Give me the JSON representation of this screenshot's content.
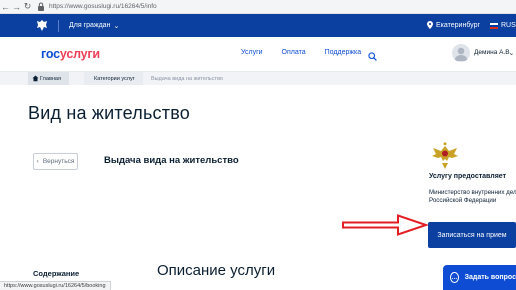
{
  "browser": {
    "url": "https://www.gosuslugi.ru/16264/5/info"
  },
  "topbar": {
    "citizens_label": "Для граждан",
    "location": "Екатеринбург",
    "language": "RUS"
  },
  "header": {
    "logo_gos": "гос",
    "logo_uslugi": "услуги",
    "nav": [
      "Услуги",
      "Оплата",
      "Поддержка"
    ],
    "user_name": "Демина А.В."
  },
  "breadcrumb": {
    "home": "Главная",
    "category": "Категории услуг",
    "current": "Выдача вида на жительство"
  },
  "main": {
    "page_title": "Вид на жительство",
    "back_label": "Вернуться",
    "service_name": "Выдача вида на жительство",
    "provider_label": "Услугу предоставляет",
    "provider_name": "Министерство внутренних дел Российской Федерации",
    "cta_label": "Записаться на прием",
    "contents_label": "Содержание",
    "section_title": "Описание услуги"
  },
  "status_url": "https://www.gosuslugi.ru/16264/5/booking",
  "help_button": "Задать вопрос",
  "colors": {
    "topbar": "#0b3fa0",
    "accent": "#0d4cd3",
    "logo_red": "#ee3f58",
    "annotation_arrow": "#e31e24"
  },
  "icons": [
    "back-arrow-icon",
    "forward-arrow-icon",
    "reload-icon",
    "lock-icon",
    "emblem-icon",
    "chevron-down-icon",
    "location-pin-icon",
    "flag-icon",
    "search-icon",
    "avatar-icon",
    "home-icon",
    "chevron-left-icon",
    "ministry-emblem-icon",
    "chat-icon"
  ]
}
